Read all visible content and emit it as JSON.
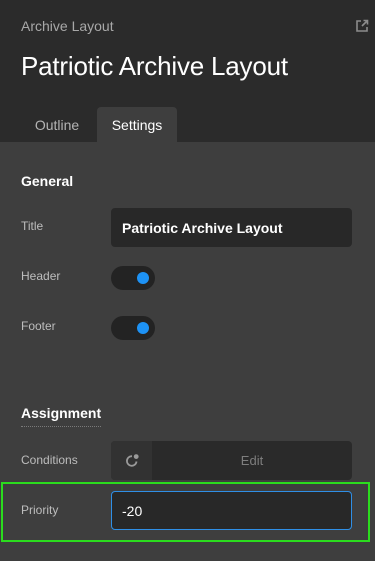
{
  "header": {
    "breadcrumb": "Archive Layout",
    "title": "Patriotic Archive Layout",
    "export_icon": "external-link-icon"
  },
  "tabs": [
    {
      "label": "Outline",
      "active": false
    },
    {
      "label": "Settings",
      "active": true
    }
  ],
  "general": {
    "heading": "General",
    "title_label": "Title",
    "title_value": "Patriotic Archive Layout",
    "header_label": "Header",
    "header_enabled": true,
    "footer_label": "Footer",
    "footer_enabled": true
  },
  "assignment": {
    "heading": "Assignment",
    "conditions_label": "Conditions",
    "conditions_icon": "conditions-icon",
    "edit_label": "Edit",
    "priority_label": "Priority",
    "priority_value": "-20"
  },
  "colors": {
    "accent": "#1d92f5",
    "highlight": "#2bdc1e"
  }
}
